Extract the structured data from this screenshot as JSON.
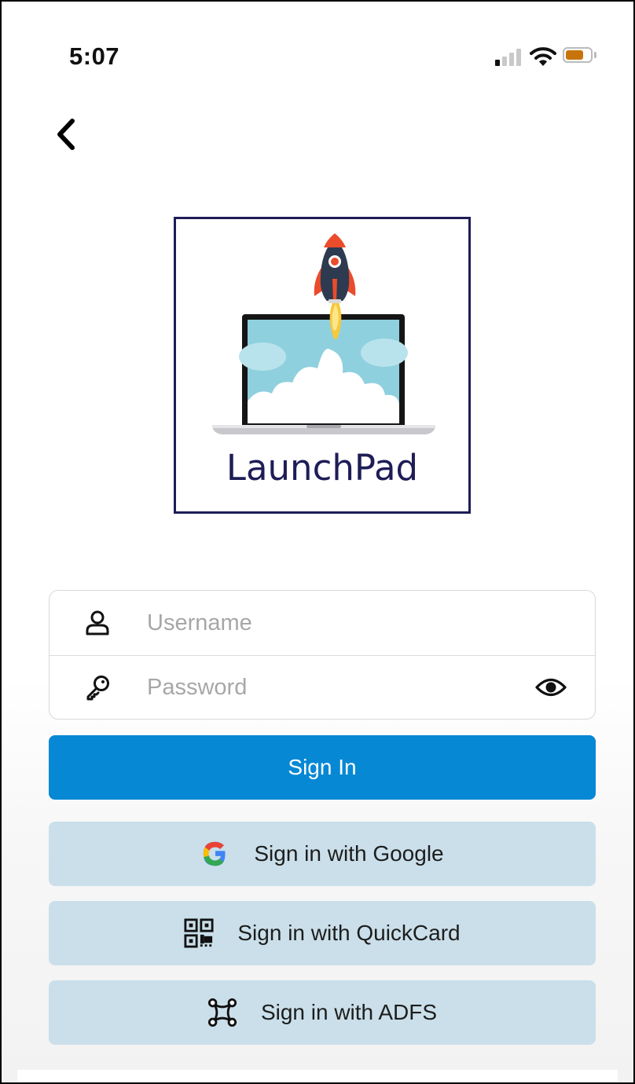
{
  "status_bar": {
    "time": "5:07",
    "battery_color": "#c8740c"
  },
  "nav": {
    "back_icon": "chevron-left-icon"
  },
  "logo": {
    "text": "LaunchPad",
    "border_color": "#1e1d57"
  },
  "form": {
    "username": {
      "placeholder": "Username",
      "value": "",
      "icon": "user-icon"
    },
    "password": {
      "placeholder": "Password",
      "value": "",
      "icon": "key-icon",
      "toggle_icon": "eye-icon"
    }
  },
  "actions": {
    "sign_in": {
      "label": "Sign In",
      "color": "#0788d4"
    },
    "google": {
      "label": "Sign in with Google",
      "icon": "google-icon"
    },
    "quickcard": {
      "label": "Sign in with QuickCard",
      "icon": "qr-code-icon"
    },
    "adfs": {
      "label": "Sign in with ADFS",
      "icon": "network-nodes-icon"
    },
    "alt_color": "#cadfea"
  }
}
